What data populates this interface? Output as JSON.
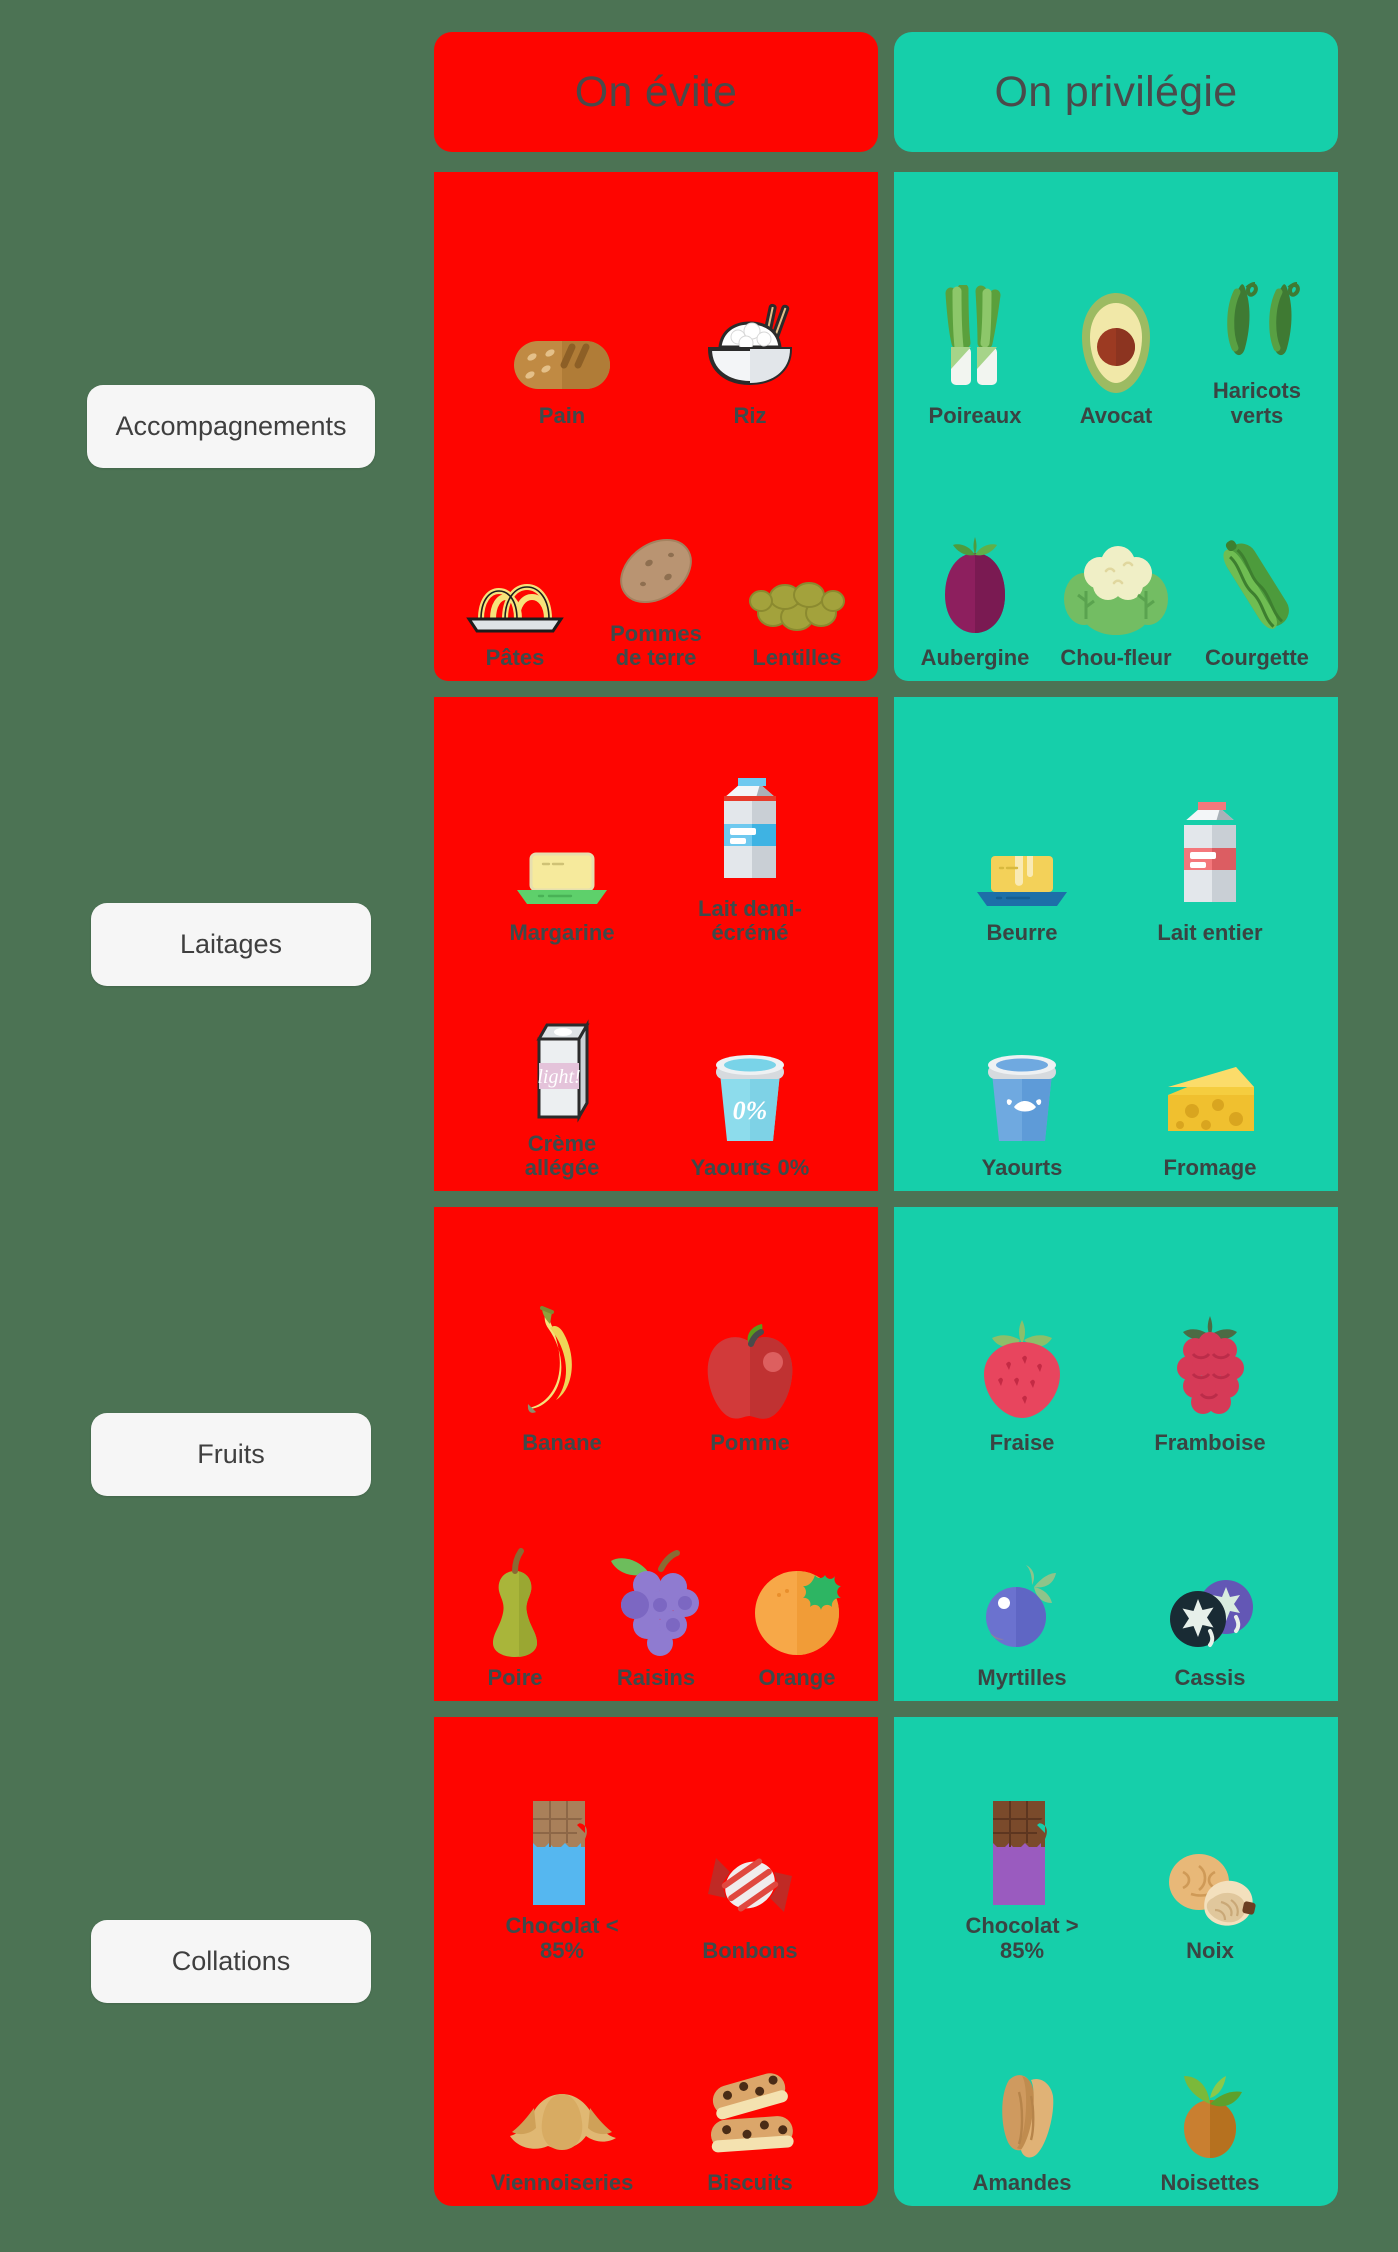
{
  "colors": {
    "background": "#4c7354",
    "avoid": "#fe0500",
    "prefer": "#16cfaa",
    "label_pill": "#f6f6f6",
    "text_dark": "#3f3f3f"
  },
  "headers": {
    "avoid": "On évite",
    "prefer": "On privilégie"
  },
  "rows": [
    {
      "label": "Accompagnements",
      "avoid": {
        "line1": [
          {
            "name": "Pain",
            "icon": "bread-icon"
          },
          {
            "name": "Riz",
            "icon": "rice-bowl-icon"
          }
        ],
        "line2": [
          {
            "name": "Pâtes",
            "icon": "pasta-icon"
          },
          {
            "name": "Pommes\nde terre",
            "icon": "potato-icon"
          },
          {
            "name": "Lentilles",
            "icon": "lentils-icon"
          }
        ]
      },
      "prefer": {
        "line1": [
          {
            "name": "Poireaux",
            "icon": "leek-icon"
          },
          {
            "name": "Avocat",
            "icon": "avocado-icon"
          },
          {
            "name": "Haricots verts",
            "icon": "green-beans-icon"
          }
        ],
        "line2": [
          {
            "name": "Aubergine",
            "icon": "eggplant-icon"
          },
          {
            "name": "Chou-fleur",
            "icon": "cauliflower-icon"
          },
          {
            "name": "Courgette",
            "icon": "zucchini-icon"
          }
        ]
      }
    },
    {
      "label": "Laitages",
      "avoid": {
        "line1": [
          {
            "name": "Margarine",
            "icon": "margarine-icon"
          },
          {
            "name": "Lait demi-écrémé",
            "icon": "milk-carton-blue-icon"
          }
        ],
        "line2": [
          {
            "name": "Crème allégée",
            "icon": "light-cream-carton-icon"
          },
          {
            "name": "Yaourts 0%",
            "icon": "yogurt-tub-zero-icon"
          }
        ]
      },
      "prefer": {
        "line1": [
          {
            "name": "Beurre",
            "icon": "butter-icon"
          },
          {
            "name": "Lait entier",
            "icon": "milk-carton-red-icon"
          }
        ],
        "line2": [
          {
            "name": "Yaourts",
            "icon": "yogurt-tub-icon"
          },
          {
            "name": "Fromage",
            "icon": "cheese-icon"
          }
        ]
      }
    },
    {
      "label": "Fruits",
      "avoid": {
        "line1": [
          {
            "name": "Banane",
            "icon": "banana-icon"
          },
          {
            "name": "Pomme",
            "icon": "apple-icon"
          }
        ],
        "line2": [
          {
            "name": "Poire",
            "icon": "pear-icon"
          },
          {
            "name": "Raisins",
            "icon": "grapes-icon"
          },
          {
            "name": "Orange",
            "icon": "orange-icon"
          }
        ]
      },
      "prefer": {
        "line1": [
          {
            "name": "Fraise",
            "icon": "strawberry-icon"
          },
          {
            "name": "Framboise",
            "icon": "raspberry-icon"
          }
        ],
        "line2": [
          {
            "name": "Myrtilles",
            "icon": "blueberry-icon"
          },
          {
            "name": "Cassis",
            "icon": "blackcurrant-icon"
          }
        ]
      }
    },
    {
      "label": "Collations",
      "avoid": {
        "line1": [
          {
            "name": "Chocolat < 85%",
            "icon": "milk-chocolate-bar-icon"
          },
          {
            "name": "Bonbons",
            "icon": "candy-icon"
          }
        ],
        "line2": [
          {
            "name": "Viennoiseries",
            "icon": "croissant-icon"
          },
          {
            "name": "Biscuits",
            "icon": "cookies-icon"
          }
        ]
      },
      "prefer": {
        "line1": [
          {
            "name": "Chocolat > 85%",
            "icon": "dark-chocolate-bar-icon"
          },
          {
            "name": "Noix",
            "icon": "walnut-icon"
          }
        ],
        "line2": [
          {
            "name": "Amandes",
            "icon": "almond-icon"
          },
          {
            "name": "Noisettes",
            "icon": "hazelnut-icon"
          }
        ]
      }
    }
  ]
}
